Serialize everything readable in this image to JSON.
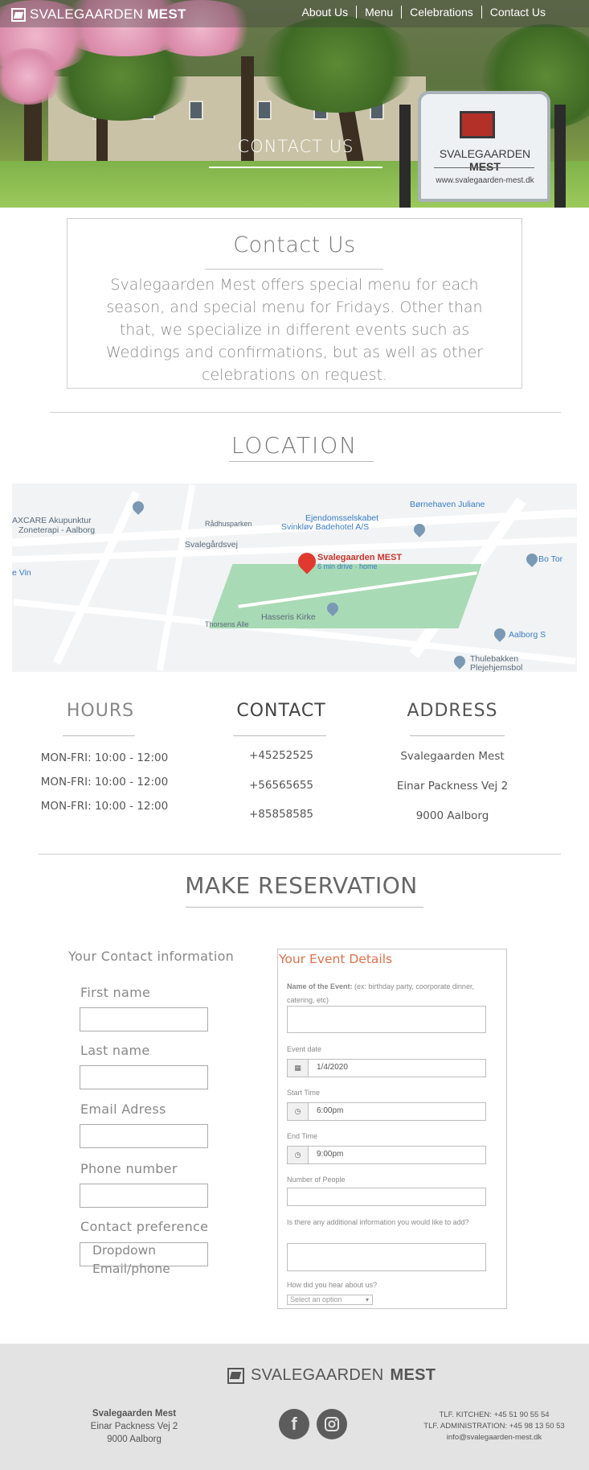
{
  "header": {
    "logo": {
      "text": "SVALEGAARDEN",
      "bold": "MEST"
    },
    "nav": [
      {
        "label": "About Us"
      },
      {
        "label": "Menu"
      },
      {
        "label": "Celebrations"
      },
      {
        "label": "Contact Us"
      }
    ],
    "hero_title": "CONTACT US",
    "sign": {
      "name": "SVALEGAARDEN",
      "bold": "MEST",
      "url": "www.svalegaarden-mest.dk"
    }
  },
  "intro": {
    "title": "Contact Us",
    "text": "Svalegaarden Mest offers special menu for each season, and special menu for Fridays. Other than that, we specialize in different events such as Weddings and confirmations, but as well as other celebrations on request."
  },
  "location": {
    "title": "LOCATION",
    "map": {
      "pin_label": "Svalegaarden MEST",
      "pin_sub": "6 min drive · home",
      "labels": [
        "Børnehaven Juliane",
        "AXCARE Akupunktur",
        "Zoneterapi - Aalborg",
        "Ejendomsselskabet",
        "Svinkløv Badehotel A/S",
        "Svalegårdsvej",
        "Rådhusparken",
        "Bo Tor",
        "e Vin",
        "Hasseris Kirke",
        "Thorsens Alle",
        "Aalborg S",
        "Thulebakken",
        "Plejehjemsbol"
      ]
    }
  },
  "hours": {
    "title": "HOURS",
    "lines": [
      "MON-FRI: 10:00 - 12:00",
      "MON-FRI: 10:00 - 12:00",
      "MON-FRI: 10:00 - 12:00"
    ]
  },
  "contact": {
    "title": "CONTACT",
    "lines": [
      "+45252525",
      "+56565655",
      "+85858585"
    ]
  },
  "address": {
    "title": "ADDRESS",
    "lines": [
      "Svalegaarden Mest",
      "Einar Packness Vej 2",
      "9000 Aalborg"
    ]
  },
  "reservation": {
    "title": "MAKE RESERVATION",
    "contact_form": {
      "heading": "Your Contact information",
      "first_name": "First name",
      "last_name": "Last name",
      "email": "Email Adress",
      "phone": "Phone number",
      "preference": "Contact preference",
      "preference_value": "Dropdown Email/phone"
    },
    "event_form": {
      "heading": "Your Event Details",
      "name_label": "Name of the Event:",
      "name_hint": "(ex: birthday party, coorporate dinner, catering, etc)",
      "date_label": "Event date",
      "date_value": "1/4/2020",
      "start_label": "Start Time",
      "start_value": "6:00pm",
      "end_label": "End Time",
      "end_value": "9:00pm",
      "people_label": "Number of People",
      "info_label": "Is there any additional information you would like to add?",
      "hear_label": "How did you hear about us?",
      "hear_placeholder": "Select an option"
    }
  },
  "footer": {
    "logo": {
      "text": "SVALEGAARDEN",
      "bold": "MEST"
    },
    "address": [
      "Svalegaarden Mest",
      "Einar Packness Vej 2",
      "9000 Aalborg"
    ],
    "contacts": [
      "TLF. KITCHEN: +45 51 90 55 54",
      "TLF. ADMINISTRATION: +45 98 13 50 53",
      "info@svalegaarden-mest.dk"
    ],
    "social": [
      "facebook-icon",
      "instagram-icon"
    ]
  },
  "colors": {
    "accent": "#e0714b",
    "footer_bg": "#e3e3e3",
    "map_pin": "#e03a2e"
  }
}
